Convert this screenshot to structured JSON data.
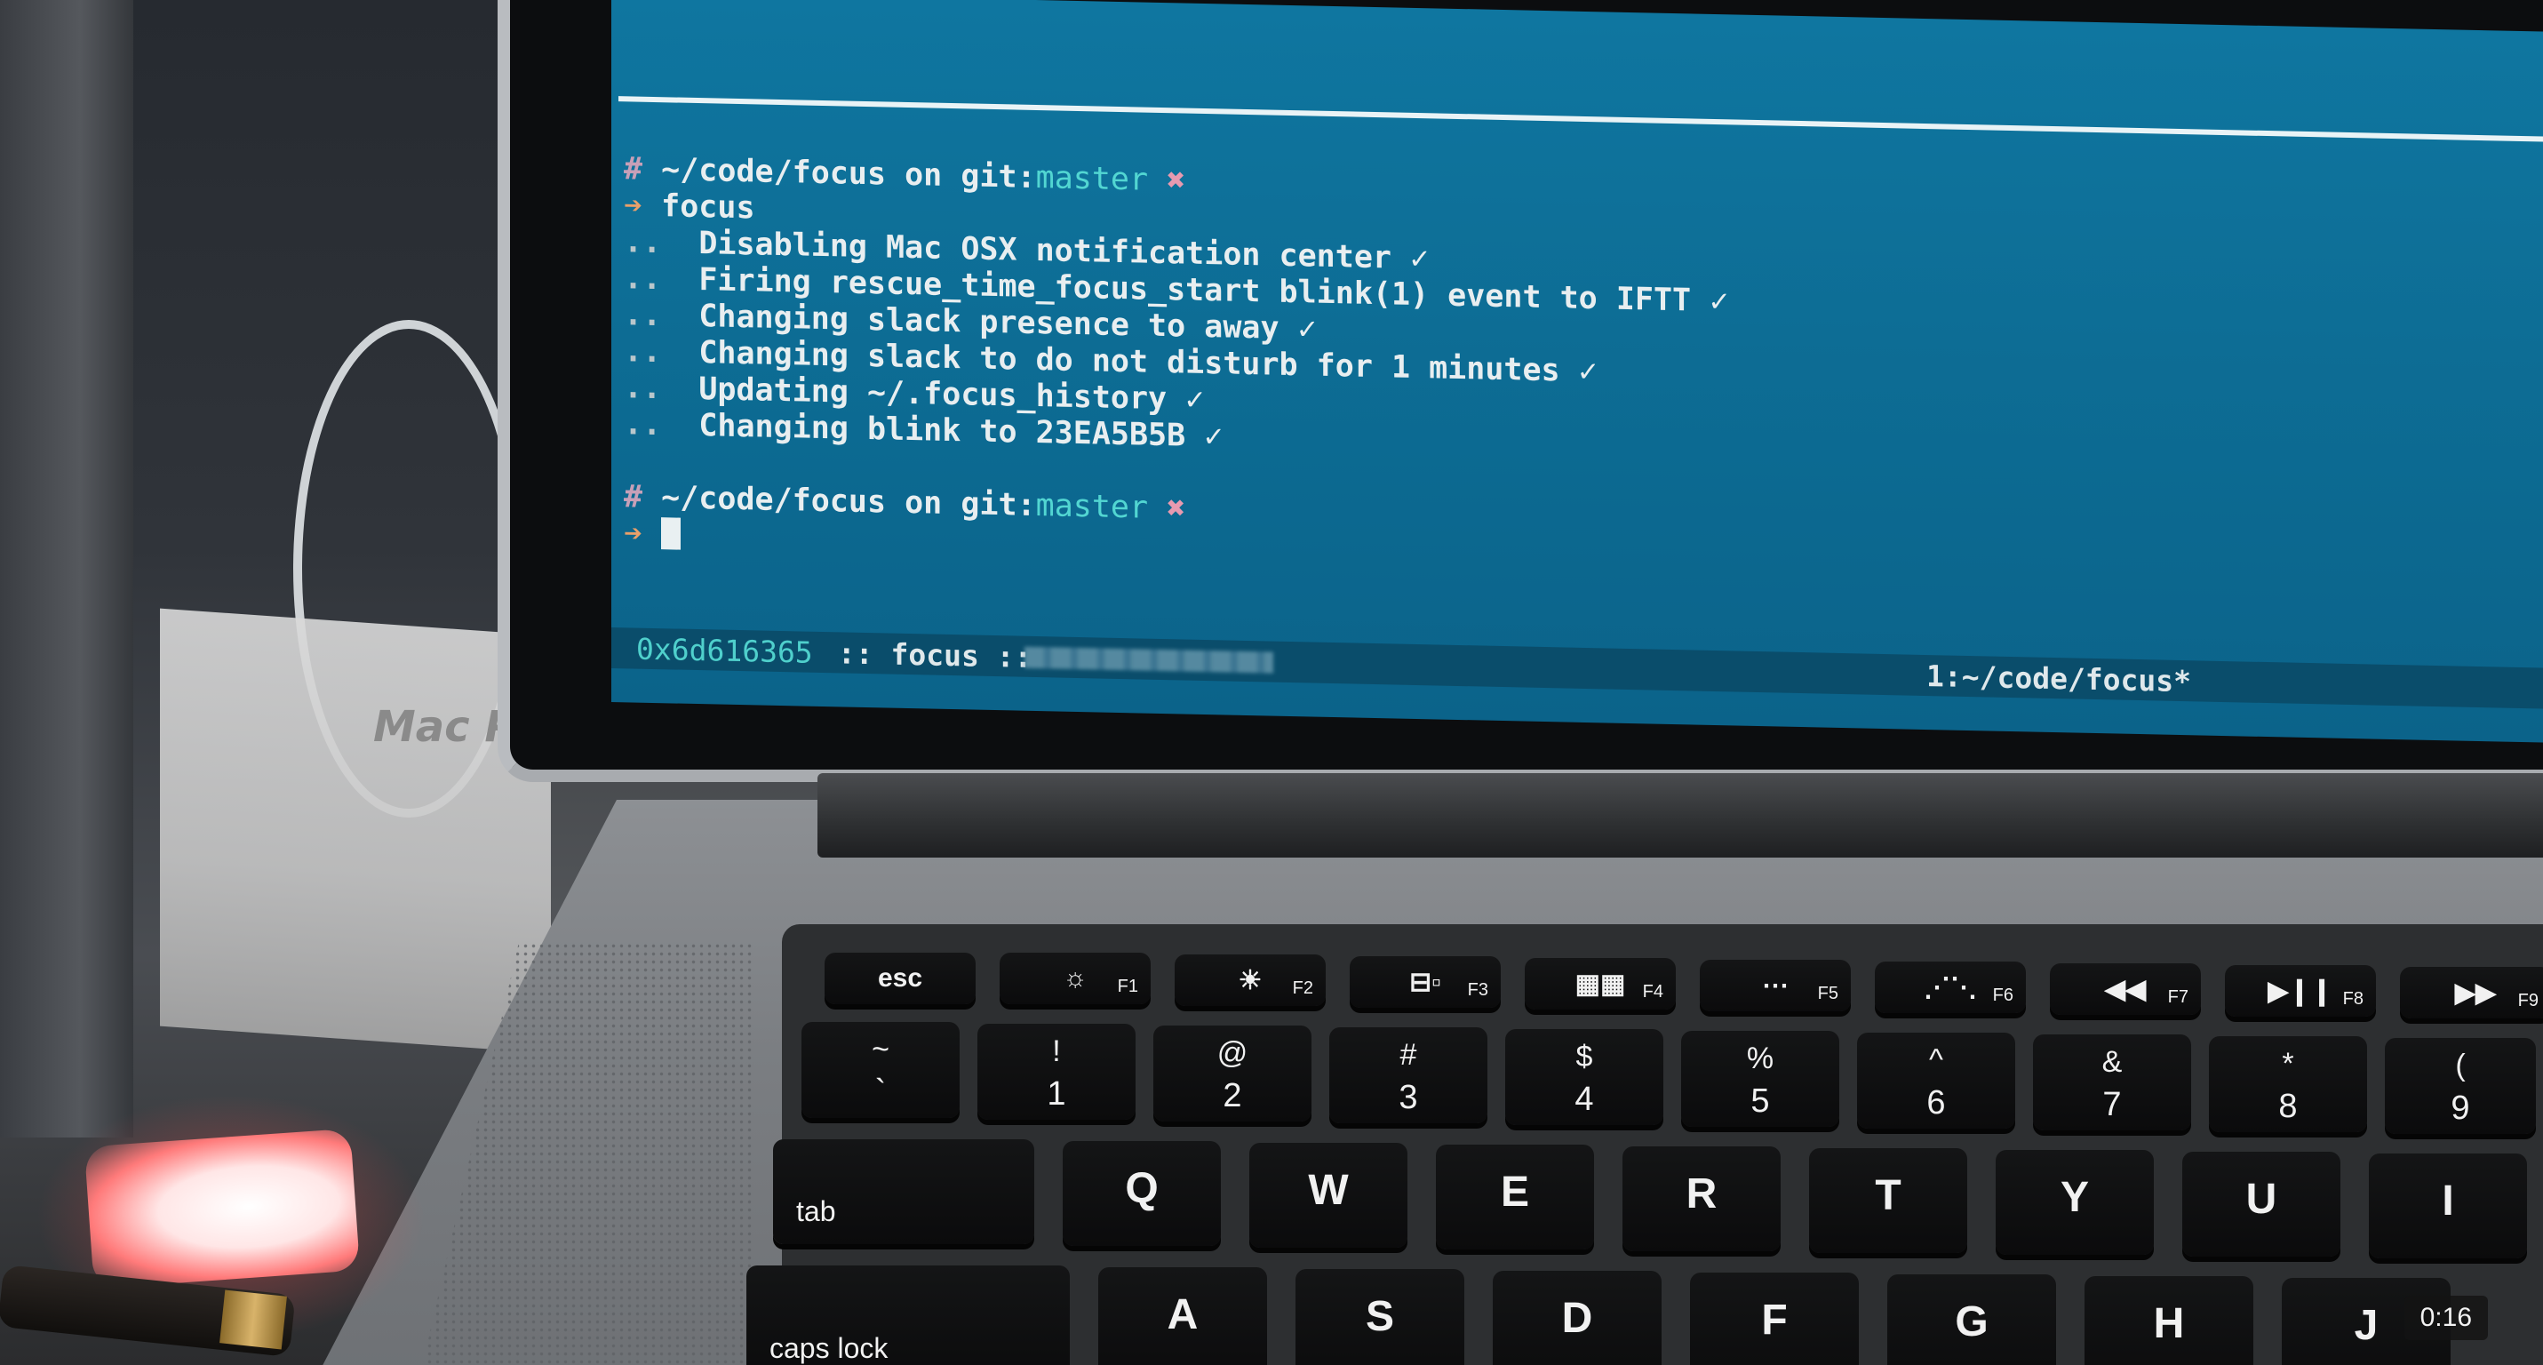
{
  "terminal": {
    "prompt1": {
      "symbol": "#",
      "path": "~/code/focus",
      "on": "on",
      "git_prefix": "git:",
      "branch": "master",
      "dirty": "✖"
    },
    "command": {
      "arrow": "➔",
      "text": "focus"
    },
    "output": [
      {
        "prefix": "..",
        "text": "Disabling Mac OSX notification center ✓"
      },
      {
        "prefix": "..",
        "text": "Firing rescue_time_focus_start blink(1) event to IFTT ✓"
      },
      {
        "prefix": "..",
        "text": "Changing slack presence to away ✓"
      },
      {
        "prefix": "..",
        "text": "Changing slack to do not disturb for 1 minutes ✓"
      },
      {
        "prefix": "..",
        "text": "Updating ~/.focus_history ✓"
      },
      {
        "prefix": "..",
        "text": "Changing blink to 23EA5B5B ✓"
      }
    ],
    "prompt2": {
      "symbol": "#",
      "path": "~/code/focus",
      "on": "on",
      "git_prefix": "git:",
      "branch": "master",
      "dirty": "✖"
    },
    "prompt2_arrow": "➔"
  },
  "tmux_status": {
    "session": "0x6d616365",
    "middle": " :: focus :: ",
    "window": "1:~/code/focus*"
  },
  "keyboard": {
    "function_row": [
      {
        "label": "esc",
        "fn": ""
      },
      {
        "label": "☼",
        "fn": "F1"
      },
      {
        "label": "☀",
        "fn": "F2"
      },
      {
        "label": "⊟▫",
        "fn": "F3"
      },
      {
        "label": "▦▦",
        "fn": "F4"
      },
      {
        "label": "⋯",
        "fn": "F5"
      },
      {
        "label": "⋰⋱",
        "fn": "F6"
      },
      {
        "label": "◀◀",
        "fn": "F7"
      },
      {
        "label": "▶❙❙",
        "fn": "F8"
      },
      {
        "label": "▶▶",
        "fn": "F9"
      }
    ],
    "number_row": [
      {
        "top": "~",
        "bottom": "`"
      },
      {
        "top": "!",
        "bottom": "1"
      },
      {
        "top": "@",
        "bottom": "2"
      },
      {
        "top": "#",
        "bottom": "3"
      },
      {
        "top": "$",
        "bottom": "4"
      },
      {
        "top": "%",
        "bottom": "5"
      },
      {
        "top": "^",
        "bottom": "6"
      },
      {
        "top": "&",
        "bottom": "7"
      },
      {
        "top": "*",
        "bottom": "8"
      },
      {
        "top": "(",
        "bottom": "9"
      }
    ],
    "tab_label": "tab",
    "top_letters": [
      "Q",
      "W",
      "E",
      "R",
      "T",
      "Y",
      "U",
      "I"
    ],
    "caps_label": "caps lock",
    "home_letters": [
      "A",
      "S",
      "D",
      "F",
      "G",
      "H",
      "J"
    ]
  },
  "background": {
    "shelf_label": "Mac Pr"
  },
  "video": {
    "timestamp": "0:16"
  }
}
